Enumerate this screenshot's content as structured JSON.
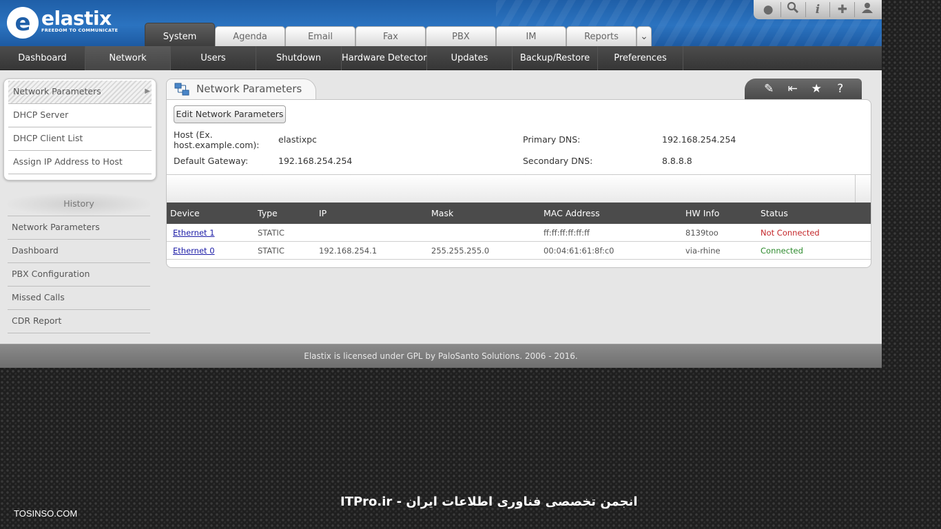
{
  "header": {
    "logo_text": "elastix",
    "logo_tagline": "FREEDOM TO COMMUNICATE",
    "toolbar_icons": [
      "theme-drop-icon",
      "search-icon",
      "info-icon",
      "addons-puzzle-icon",
      "user-icon"
    ],
    "tabs": [
      {
        "label": "System",
        "active": true
      },
      {
        "label": "Agenda"
      },
      {
        "label": "Email"
      },
      {
        "label": "Fax"
      },
      {
        "label": "PBX"
      },
      {
        "label": "IM"
      },
      {
        "label": "Reports"
      }
    ],
    "more_tabs_glyph": "⌄"
  },
  "subnav": {
    "items": [
      {
        "label": "Dashboard"
      },
      {
        "label": "Network",
        "active": true
      },
      {
        "label": "Users"
      },
      {
        "label": "Shutdown"
      },
      {
        "label": "Hardware Detector"
      },
      {
        "label": "Updates"
      },
      {
        "label": "Backup/Restore"
      },
      {
        "label": "Preferences"
      }
    ]
  },
  "sidebar": {
    "items": [
      {
        "label": "Network Parameters",
        "active": true
      },
      {
        "label": "DHCP Server"
      },
      {
        "label": "DHCP Client List"
      },
      {
        "label": "Assign IP Address to Host"
      }
    ],
    "history_title": "History",
    "history": [
      {
        "label": "Network Parameters"
      },
      {
        "label": "Dashboard"
      },
      {
        "label": "PBX Configuration"
      },
      {
        "label": "Missed Calls"
      },
      {
        "label": "CDR Report"
      }
    ]
  },
  "main": {
    "title": "Network Parameters",
    "title_tools": [
      "edit-icon",
      "collapse-panel-icon",
      "favorite-star-icon",
      "help-icon"
    ],
    "edit_button": "Edit Network Parameters",
    "params": {
      "host_label_1": "Host (Ex.",
      "host_label_2": "host.example.com):",
      "host_value": "elastixpc",
      "gateway_label": "Default Gateway:",
      "gateway_value": "192.168.254.254",
      "primary_dns_label": "Primary DNS:",
      "primary_dns_value": "192.168.254.254",
      "secondary_dns_label": "Secondary DNS:",
      "secondary_dns_value": "8.8.8.8"
    },
    "table": {
      "headers": [
        "Device",
        "Type",
        "IP",
        "Mask",
        "MAC Address",
        "HW Info",
        "Status"
      ],
      "rows": [
        {
          "device": "Ethernet 1",
          "type": "STATIC",
          "ip": "",
          "mask": "",
          "mac": "ff:ff:ff:ff:ff:ff",
          "hw": "8139too",
          "status": "Not Connected",
          "status_color": "#c4272a"
        },
        {
          "device": "Ethernet 0",
          "type": "STATIC",
          "ip": "192.168.254.1",
          "mask": "255.255.255.0",
          "mac": "00:04:61:61:8f:c0",
          "hw": "via-rhine",
          "status": "Connected",
          "status_color": "#2e8b2e"
        }
      ]
    }
  },
  "footer": {
    "text": "Elastix is licensed under GPL by PaloSanto Solutions. 2006 - 2016."
  },
  "overlay": {
    "watermark": "ITPro.ir - انجمن تخصصی فناوری اطلاعات ایران",
    "site": "TOSINSO.COM"
  },
  "colors": {
    "header_blue": "#2b73c0",
    "nav_dark": "#404040",
    "not_connected": "#c4272a",
    "connected": "#2e8b2e",
    "link": "#1a1aa6"
  }
}
